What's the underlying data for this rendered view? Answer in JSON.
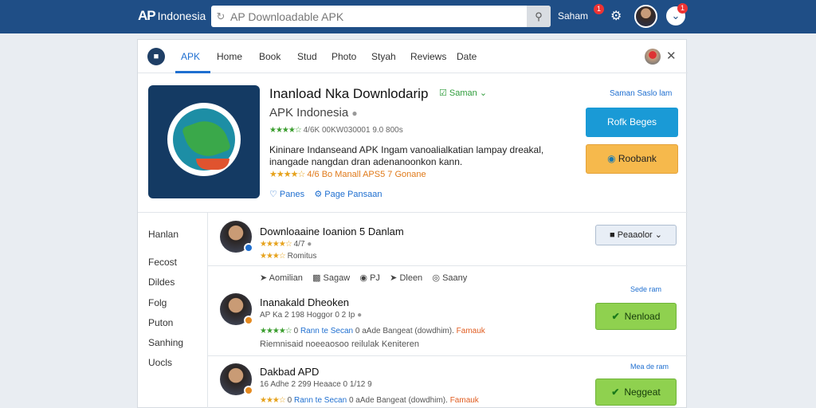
{
  "header": {
    "logo_mark": "AP",
    "logo_text": "Indonesia",
    "search_placeholder": "AP Downloadable APK",
    "user_label": "Saham",
    "notif_count_1": "1",
    "notif_count_2": "1"
  },
  "tabs": [
    {
      "label": "APK"
    },
    {
      "label": "Home"
    },
    {
      "label": "Book"
    },
    {
      "label": "Stud"
    },
    {
      "label": "Photo"
    },
    {
      "label": "Styah"
    },
    {
      "label": "Reviews"
    },
    {
      "label": "Date"
    }
  ],
  "app": {
    "title": "Inanload Nka Downlodarip",
    "follow": "Saman",
    "subtitle": "APK Indonesia",
    "rating_text": "4/6K  00KW030001 9.0 800s",
    "description": "Kininare Indanseand APK Ingam vanoalialkatian lampay dreakal, inangade nangdan dran adenanoonkon kann.",
    "stats_text": "4/6  Bo Manall APS5 7 Gonane",
    "link_1": "Panes",
    "link_2": "Page Pansaan",
    "meta": "Saman Saslo lam",
    "install_label": "Rofk Beges",
    "bookmark_label": "Roobank"
  },
  "sidebar": [
    "Hanlan",
    "Fecost",
    "Dildes",
    "Folg",
    "Puton",
    "Sanhing",
    "Uocls"
  ],
  "reviews": [
    {
      "title": "Downloaaine Ioanion  5 Danlam",
      "line1": "4/7",
      "line2": "Romitus",
      "actions": [
        "Aomilian",
        "Sagaw",
        "PJ",
        "Dleen",
        "Saany"
      ],
      "button": "Peaaolor"
    },
    {
      "title": "Inanakald Dheoken",
      "line1": "AP Ka  2 198  Hoggor 0 2 Ip",
      "line2_a": "0",
      "line2_b": "Rann te Secan",
      "line2_c": "0 aAde Bangeat (dowdhim).",
      "line2_d": "Famauk",
      "line3": "Riemnisaid noeeaosoo reilulak Keniteren",
      "when": "Sede ram",
      "button": "Nenload"
    },
    {
      "title": "Dakbad APD",
      "line1": "16 Adhe 2 299  Heaace 0 1/12  9",
      "line2_a": "0",
      "line2_b": "Rann te Secan",
      "line2_c": "0 aAde Bangeat (dowdhim).",
      "line2_d": "Famauk",
      "when": "Mea de ram",
      "button": "Neggeat"
    }
  ]
}
